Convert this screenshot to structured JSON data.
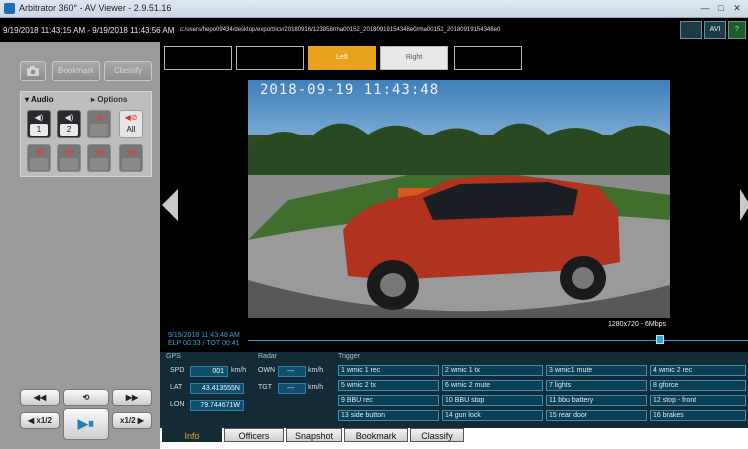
{
  "window": {
    "title": "Arbitrator 360° - AV Viewer - 2.9.51.16",
    "buttons": [
      "—",
      "□",
      "✕"
    ]
  },
  "header": {
    "date_range": "9/19/2018 11:43:15 AM - 9/19/2018 11:43:56 AM",
    "file_path": "c:/users/hepo09434/desktop/export/icv/20180916/123858/rha00152_20180919154348e0/rha00152_20180919154348e0",
    "toolbar_icons": [
      "monitor-icon",
      "avi-icon",
      "help-icon"
    ],
    "toolbar_labels": [
      "",
      "AVI",
      "?"
    ]
  },
  "left_panel": {
    "snapshot_icon": "camera-icon",
    "bookmark_label": "Bookmark",
    "classify_label": "Classify",
    "audio_tab": "Audio",
    "options_tab": "Options",
    "mics_row1": [
      "1",
      "2",
      "",
      "All"
    ],
    "mics_row2": [
      "",
      "",
      "",
      ""
    ]
  },
  "playback_controls": {
    "skip_back": "◀◀",
    "loop": "⟲",
    "skip_forward": "▶▶",
    "slow_back": "◀ x1/2",
    "play_pause": "▶⏸",
    "slow_forward": "x1/2 ▶"
  },
  "viewer": {
    "camera_tabs": [
      "",
      "",
      "Left",
      "Right",
      ""
    ],
    "overlay_timestamp": "2018-09-19 11:43:48",
    "resolution": "1280x720 - 6Mbps"
  },
  "timeline": {
    "current_time": "9/19/2018 11:43:48 AM",
    "elapsed": "ELP 00:33 / TOT 00:41"
  },
  "info": {
    "gps_title": "GPS",
    "radar_title": "Radar",
    "trigger_title": "Trigger",
    "spd_label": "SPD",
    "spd_value": "001",
    "spd_unit": "km/h",
    "lat_label": "LAT",
    "lat_value": "43.413555N",
    "lon_label": "LON",
    "lon_value": "79.744671W",
    "own_label": "OWN",
    "own_value": "---",
    "own_unit": "km/h",
    "tgt_label": "TGT",
    "tgt_value": "---",
    "tgt_unit": "km/h",
    "triggers": [
      "1 wmic 1 rec",
      "2 wmic 1 tx",
      "3 wmic1 mute",
      "4 wmic 2 rec",
      "5 wmic 2 tx",
      "6 wmic 2 mute",
      "7 lights",
      "8 gforce",
      "9 BBU rec",
      "10 BBU stop",
      "11 bbu battery",
      "12 stop - front",
      "13 side button",
      "14 gun lock",
      "15 rear door",
      "16 brakes"
    ]
  },
  "bottom_tabs": [
    "Info",
    "Officers",
    "Snapshot",
    "Bookmark",
    "Classify"
  ]
}
